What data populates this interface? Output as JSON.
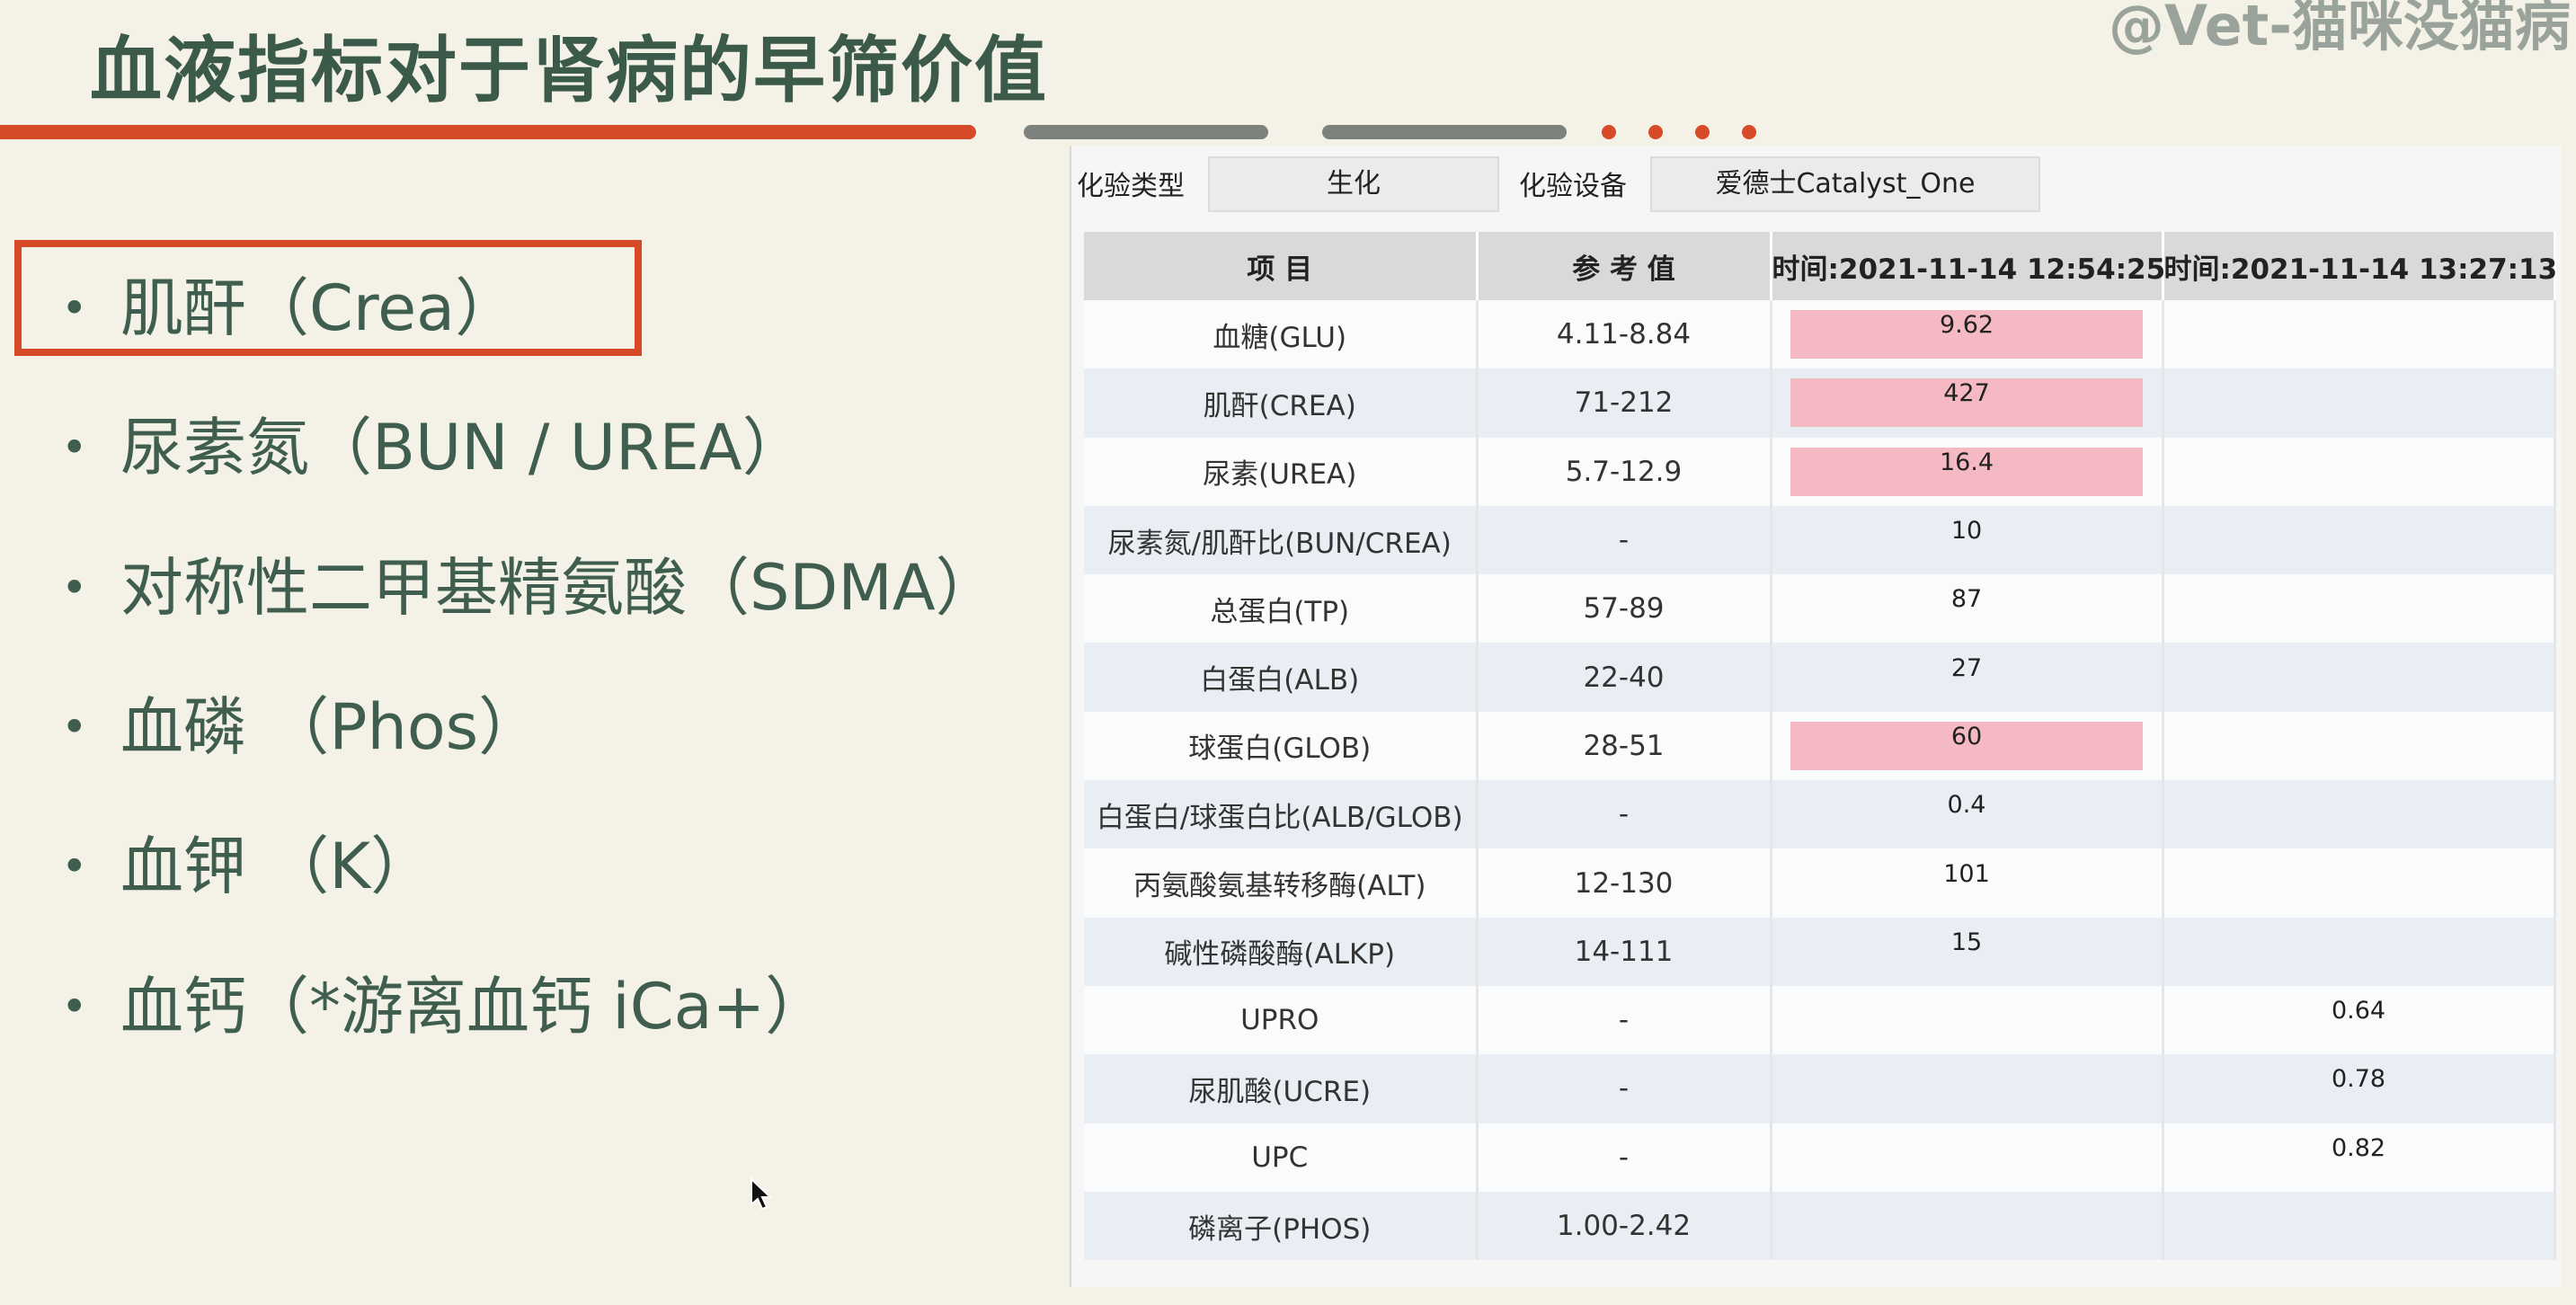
{
  "slide": {
    "title": "血液指标对于肾病的早筛价值",
    "watermark": "@Vet-猫咪没猫病",
    "accent_color": "#d64a28",
    "text_color": "#3f5e4f"
  },
  "bullets": [
    {
      "text": "肌酐（Crea）",
      "highlighted": true
    },
    {
      "text": "尿素氮（BUN / UREA）",
      "highlighted": false
    },
    {
      "text": "对称性二甲基精氨酸（SDMA）",
      "highlighted": false
    },
    {
      "text": "血磷 （Phos）",
      "highlighted": false
    },
    {
      "text": "血钾 （K）",
      "highlighted": false
    },
    {
      "text": "血钙（*游离血钙 iCa+）",
      "highlighted": false
    }
  ],
  "lab_panel": {
    "filter_type_label": "化验类型",
    "filter_type_value": "生化",
    "filter_device_label": "化验设备",
    "filter_device_value": "爱德士Catalyst_One",
    "columns": [
      "项 目",
      "参 考 值",
      "时间:2021-11-14 12:54:25",
      "时间:2021-11-14 13:27:13"
    ],
    "highlight_color": "#f5b9c3",
    "rows": [
      {
        "item": "血糖(GLU)",
        "ref": "4.11-8.84",
        "v1": "9.62",
        "v1_high": true,
        "v2": ""
      },
      {
        "item": "肌酐(CREA)",
        "ref": "71-212",
        "v1": "427",
        "v1_high": true,
        "v2": ""
      },
      {
        "item": "尿素(UREA)",
        "ref": "5.7-12.9",
        "v1": "16.4",
        "v1_high": true,
        "v2": ""
      },
      {
        "item": "尿素氮/肌酐比(BUN/CREA)",
        "ref": "-",
        "v1": "10",
        "v1_high": false,
        "v2": ""
      },
      {
        "item": "总蛋白(TP)",
        "ref": "57-89",
        "v1": "87",
        "v1_high": false,
        "v2": ""
      },
      {
        "item": "白蛋白(ALB)",
        "ref": "22-40",
        "v1": "27",
        "v1_high": false,
        "v2": ""
      },
      {
        "item": "球蛋白(GLOB)",
        "ref": "28-51",
        "v1": "60",
        "v1_high": true,
        "v2": ""
      },
      {
        "item": "白蛋白/球蛋白比(ALB/GLOB)",
        "ref": "-",
        "v1": "0.4",
        "v1_high": false,
        "v2": ""
      },
      {
        "item": "丙氨酸氨基转移酶(ALT)",
        "ref": "12-130",
        "v1": "101",
        "v1_high": false,
        "v2": ""
      },
      {
        "item": "碱性磷酸酶(ALKP)",
        "ref": "14-111",
        "v1": "15",
        "v1_high": false,
        "v2": ""
      },
      {
        "item": "UPRO",
        "ref": "-",
        "v1": "",
        "v1_high": false,
        "v2": "0.64"
      },
      {
        "item": "尿肌酸(UCRE)",
        "ref": "-",
        "v1": "",
        "v1_high": false,
        "v2": "0.78"
      },
      {
        "item": "UPC",
        "ref": "-",
        "v1": "",
        "v1_high": false,
        "v2": "0.82"
      },
      {
        "item": "磷离子(PHOS)",
        "ref": "1.00-2.42",
        "v1": "",
        "v1_high": false,
        "v2": ""
      }
    ]
  }
}
